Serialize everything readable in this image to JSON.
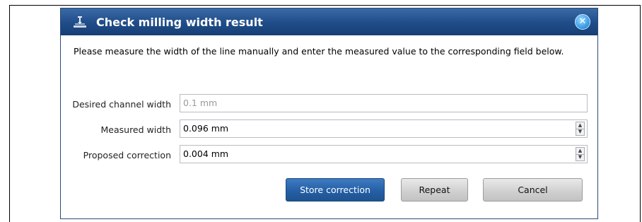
{
  "dialog": {
    "title": "Check milling width result",
    "close_glyph": "✕",
    "instruction": "Please measure the width of the line manually and enter the measured value to the corresponding field below."
  },
  "fields": {
    "desired": {
      "label": "Desired channel width",
      "value": "0.1 mm"
    },
    "measured": {
      "label": "Measured width",
      "value": "0.096 mm"
    },
    "proposed": {
      "label": "Proposed correction",
      "value": "0.004 mm"
    }
  },
  "buttons": {
    "store": "Store correction",
    "repeat": "Repeat",
    "cancel": "Cancel"
  },
  "icons": {
    "title": "milling-tool-icon",
    "close": "close-icon",
    "spin_up": "spin-up-arrow-icon",
    "spin_down": "spin-down-arrow-icon"
  },
  "colors": {
    "titlebar": "#1f4c88",
    "primary_button": "#255fa6",
    "secondary_button": "#cfcfcf"
  }
}
